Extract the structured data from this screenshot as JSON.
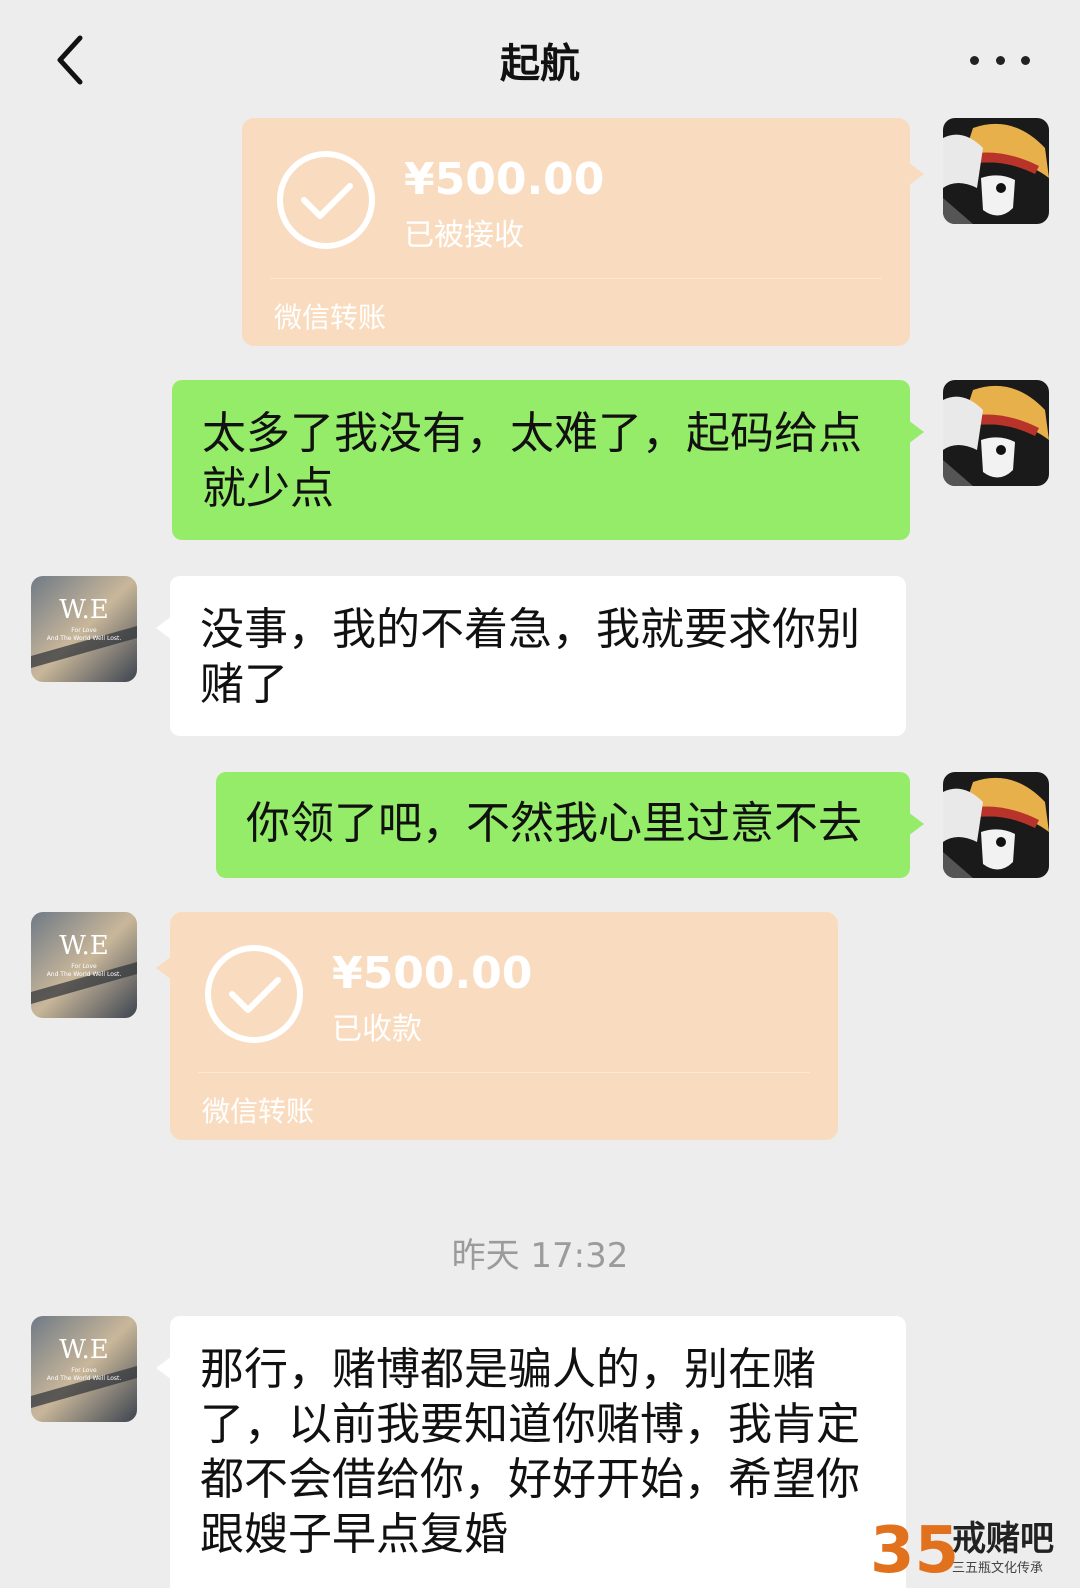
{
  "header": {
    "title": "起航"
  },
  "messages": {
    "m1": {
      "amount": "¥500.00",
      "status": "已被接收",
      "label": "微信转账"
    },
    "m2": {
      "text": "太多了我没有，太难了，起码给点就少点"
    },
    "m3": {
      "text": "没事，我的不着急，我就要求你别赌了"
    },
    "m4": {
      "text": "你领了吧，不然我心里过意不去"
    },
    "m5": {
      "amount": "¥500.00",
      "status": "已收款",
      "label": "微信转账"
    },
    "m6": {
      "text": "那行，赌博都是骗人的，别在赌了，以前我要知道你赌博，我肯定都不会借给你，好好开始，希望你跟嫂子早点复婚"
    }
  },
  "timestamp": "昨天 17:32",
  "avatar_other_text": {
    "big": "W.E",
    "small1": "For Love",
    "small2": "And The World Well Lost."
  },
  "watermark": {
    "number": "35",
    "brand": "戒赌吧",
    "sub": "三五瓶文化传承"
  },
  "colors": {
    "green_bubble": "#95ec69",
    "transfer_bubble": "#f9dcbf",
    "background": "#ededed"
  },
  "icons": [
    "back-arrow-icon",
    "more-icon",
    "check-circle-icon"
  ]
}
